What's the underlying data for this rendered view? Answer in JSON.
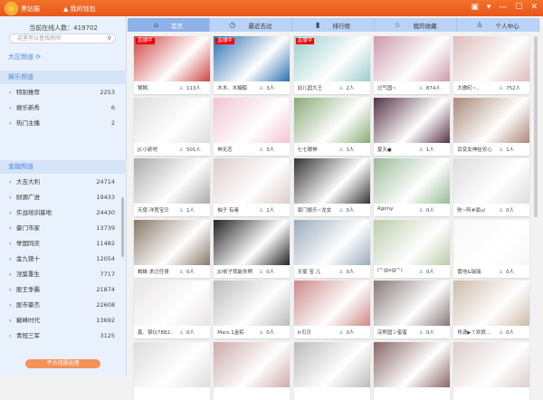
{
  "app": {
    "name": "黑钻猫",
    "wallet": "我的钱包",
    "controls": [
      "▣",
      "▾",
      "—",
      "☐",
      "✕"
    ]
  },
  "sidebar": {
    "online_label": "当前在线人数：419702",
    "search_placeholder": "这里可以查找房间",
    "region": "大区频道",
    "ent": {
      "title": "娱乐频道",
      "items": [
        {
          "label": "特别推荐",
          "count": "2253"
        },
        {
          "label": "娱乐新秀",
          "count": "6"
        },
        {
          "label": "热门主播",
          "count": "2"
        }
      ]
    },
    "fin": {
      "title": "金融频道",
      "items": [
        {
          "label": "大吉大利",
          "count": "24714"
        },
        {
          "label": "财源广进",
          "count": "19433"
        },
        {
          "label": "实战培训基地",
          "count": "24430"
        },
        {
          "label": "豪门市家",
          "count": "13739"
        },
        {
          "label": "举国同庆",
          "count": "11482"
        },
        {
          "label": "金九银十",
          "count": "12054"
        },
        {
          "label": "涅槃重生",
          "count": "7717"
        },
        {
          "label": "股王争霸",
          "count": "21874"
        },
        {
          "label": "股市豪杰",
          "count": "22608"
        },
        {
          "label": "巅峰时代",
          "count": "13692"
        },
        {
          "label": "青冠三军",
          "count": "3125"
        }
      ]
    },
    "report": "平台违规处理"
  },
  "tabs": [
    {
      "label": "首页",
      "icon": "⌂"
    },
    {
      "label": "最近去过",
      "icon": "◷"
    },
    {
      "label": "排行榜",
      "icon": "▮"
    },
    {
      "label": "我的收藏",
      "icon": "☆"
    },
    {
      "label": "个人中心",
      "icon": "♙"
    }
  ],
  "live_label": "直播中",
  "cards": [
    {
      "name": "猴猴、",
      "viewers": "113人",
      "live": true,
      "color": "#c44"
    },
    {
      "name": "木木、木糖醇",
      "viewers": "3人",
      "live": true,
      "color": "#2b6fb0"
    },
    {
      "name": "幼儿园大王",
      "viewers": "2人",
      "live": true,
      "color": "#9cc"
    },
    {
      "name": "过气国~",
      "viewers": "874人",
      "color": "#c9a"
    },
    {
      "name": "大傲町~..",
      "viewers": "752人",
      "color": "#dbb"
    },
    {
      "name": "JC小瘀吧",
      "viewers": "501人",
      "color": "#ddd"
    },
    {
      "name": "神无恋",
      "viewers": "3人",
      "color": "#f3c4d4"
    },
    {
      "name": "七七眼神",
      "viewers": "1人",
      "color": "#8a7"
    },
    {
      "name": "夏天●",
      "viewers": "1人",
      "color": "#534"
    },
    {
      "name": "百变女神娃安心",
      "viewers": "1人",
      "color": "#a87"
    },
    {
      "name": "天使 洋葱宝贝",
      "viewers": "1人",
      "color": "#aaa"
    },
    {
      "name": "柚子 有毒",
      "viewers": "1人",
      "color": "#dcc"
    },
    {
      "name": "豪门娱乐~龙女",
      "viewers": "0人",
      "color": "#333"
    },
    {
      "name": "Agony.",
      "viewers": "0人",
      "color": "#9b9"
    },
    {
      "name": "陈~阿#豪ul",
      "viewers": "0人",
      "color": "#ddd"
    },
    {
      "name": "蜘蛛 求过任哥",
      "viewers": "0人",
      "color": "#876"
    },
    {
      "name": "JD依子我能你啊",
      "viewers": "0人",
      "color": "#222"
    },
    {
      "name": "天使 宝 儿",
      "viewers": "0人",
      "color": "#9ab"
    },
    {
      "name": "(^@o@^)",
      "viewers": "0人",
      "color": "#bca"
    },
    {
      "name": "蕾地&瑞瑞",
      "viewers": "0人",
      "color": "#f7f7f7"
    },
    {
      "name": "鑫、钢仪7882..",
      "viewers": "0人",
      "color": "#e8e4e4"
    },
    {
      "name": "Mars.1金粽",
      "viewers": "0人",
      "color": "#bbb"
    },
    {
      "name": "tr贝贝",
      "viewers": "0人",
      "color": "#c88"
    },
    {
      "name": "浣熊国ン蜜蜜",
      "viewers": "0人",
      "color": "#877"
    },
    {
      "name": "肖潇▶丫欢很...",
      "viewers": "0人",
      "color": "#cba"
    },
    {
      "name": "",
      "viewers": "",
      "color": "#ddd"
    },
    {
      "name": "",
      "viewers": "",
      "color": "#caa"
    },
    {
      "name": "",
      "viewers": "",
      "color": "#bbb"
    },
    {
      "name": "",
      "viewers": "",
      "color": "#866"
    },
    {
      "name": "",
      "viewers": "",
      "color": "#dcc"
    }
  ]
}
